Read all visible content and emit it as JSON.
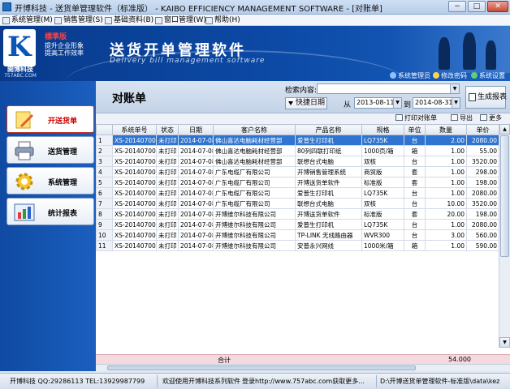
{
  "window": {
    "title": "开博科技 - 送货单管理软件（标准版） - KAIBO EFFICIENCY MANAGEMENT SOFTWARE - [对账单]",
    "min": "−",
    "max": "□",
    "close": "✕"
  },
  "menu": [
    "系统管理(M)",
    "销售管理(S)",
    "基础资料(B)",
    "窗口管理(W)",
    "帮助(H)"
  ],
  "banner": {
    "logo_letter": "K",
    "logo_cn": "開博科技",
    "logo_url": "757ABC.COM",
    "edition_badge": "標準版",
    "slogan1": "提升企业形象",
    "slogan2": "提高工作效率",
    "title": "送货开单管理软件",
    "subtitle": "Delivery bill management software",
    "links": [
      "系统管理员",
      "修改密码",
      "系统设置"
    ]
  },
  "sidebar": {
    "items": [
      {
        "label": "开送货单",
        "icon": "pencil-note-icon",
        "active": true
      },
      {
        "label": "送货管理",
        "icon": "printer-icon",
        "active": false
      },
      {
        "label": "系统管理",
        "icon": "gear-icon",
        "active": false
      },
      {
        "label": "统计报表",
        "icon": "bar-chart-icon",
        "active": false
      }
    ]
  },
  "main": {
    "title": "对账单",
    "search_label": "检索内容:",
    "search_value": "",
    "quick_date": "快捷日期",
    "from_label": "从",
    "from_date": "2013-08-11",
    "to_label": "到",
    "to_date": "2014-08-31",
    "report_button": "生成报表",
    "print_button": "打印对账单",
    "export_button": "导出",
    "more_button": "更多",
    "columns": [
      "",
      "系统单号",
      "状态",
      "日期",
      "客户名称",
      "产品名称",
      "规格",
      "单位",
      "数量",
      "单价"
    ],
    "rows": [
      [
        "1",
        "XS-201407002",
        "未打印",
        "2014-07-08",
        "佛山喜达电脑耗材经营部",
        "爱普生打印机",
        "LQ735K",
        "台",
        "2.00",
        "2080.00"
      ],
      [
        "2",
        "XS-201407002",
        "未打印",
        "2014-07-08",
        "佛山喜达电脑耗材经营部",
        "80列四联打印纸",
        "1000页/箱",
        "箱",
        "1.00",
        "55.00"
      ],
      [
        "3",
        "XS-201407002",
        "未打印",
        "2014-07-08",
        "佛山喜达电脑耗材经营部",
        "联想台式电脑",
        "双核",
        "台",
        "1.00",
        "3520.00"
      ],
      [
        "4",
        "XS-201407003",
        "未打印",
        "2014-07-08",
        "广东电缆厂有限公司",
        "开博销售管理系统",
        "商贸版",
        "套",
        "1.00",
        "298.00"
      ],
      [
        "5",
        "XS-201407003",
        "未打印",
        "2014-07-08",
        "广东电缆厂有限公司",
        "开博送货单软件",
        "标准版",
        "套",
        "1.00",
        "198.00"
      ],
      [
        "6",
        "XS-201407004",
        "未打印",
        "2014-07-08",
        "广东电缆厂有限公司",
        "爱普生打印机",
        "LQ735K",
        "台",
        "1.00",
        "2080.00"
      ],
      [
        "7",
        "XS-201407004",
        "未打印",
        "2014-07-08",
        "广东电缆厂有限公司",
        "联想台式电脑",
        "双核",
        "台",
        "10.00",
        "3520.00"
      ],
      [
        "8",
        "XS-201407001",
        "未打印",
        "2014-07-08",
        "开博维尔科技有限公司",
        "开博送货单软件",
        "标准版",
        "套",
        "20.00",
        "198.00"
      ],
      [
        "9",
        "XS-201407005",
        "未打印",
        "2014-07-08",
        "开博维尔科技有限公司",
        "爱普生打印机",
        "LQ735K",
        "台",
        "1.00",
        "2080.00"
      ],
      [
        "10",
        "XS-201407005",
        "未打印",
        "2014-07-08",
        "开博维尔科技有限公司",
        "TP-LINK 无线路由器",
        "WVR300",
        "台",
        "3.00",
        "560.00"
      ],
      [
        "11",
        "XS-201407005",
        "未打印",
        "2014-07-08",
        "开博维尔科技有限公司",
        "安普永兴网线",
        "1000米/箱",
        "箱",
        "1.00",
        "590.00"
      ]
    ],
    "selected_row": 0,
    "total_label": "合计",
    "total_qty": "54.000"
  },
  "status": {
    "company": "开博科技 QQ:29286113 TEL:13929987799",
    "welcome": "欢迎使用开博科技系列软件",
    "login": "登录http://www.757abc.com获取更多...",
    "path": "D:\\开博送货单管理软件-标准版\\data\\kez"
  },
  "colors": {
    "banner": "#0c4aa6",
    "selected_row": "#2f74d0",
    "total_row": "#f4d9df",
    "active_nav_text": "#d00000"
  }
}
